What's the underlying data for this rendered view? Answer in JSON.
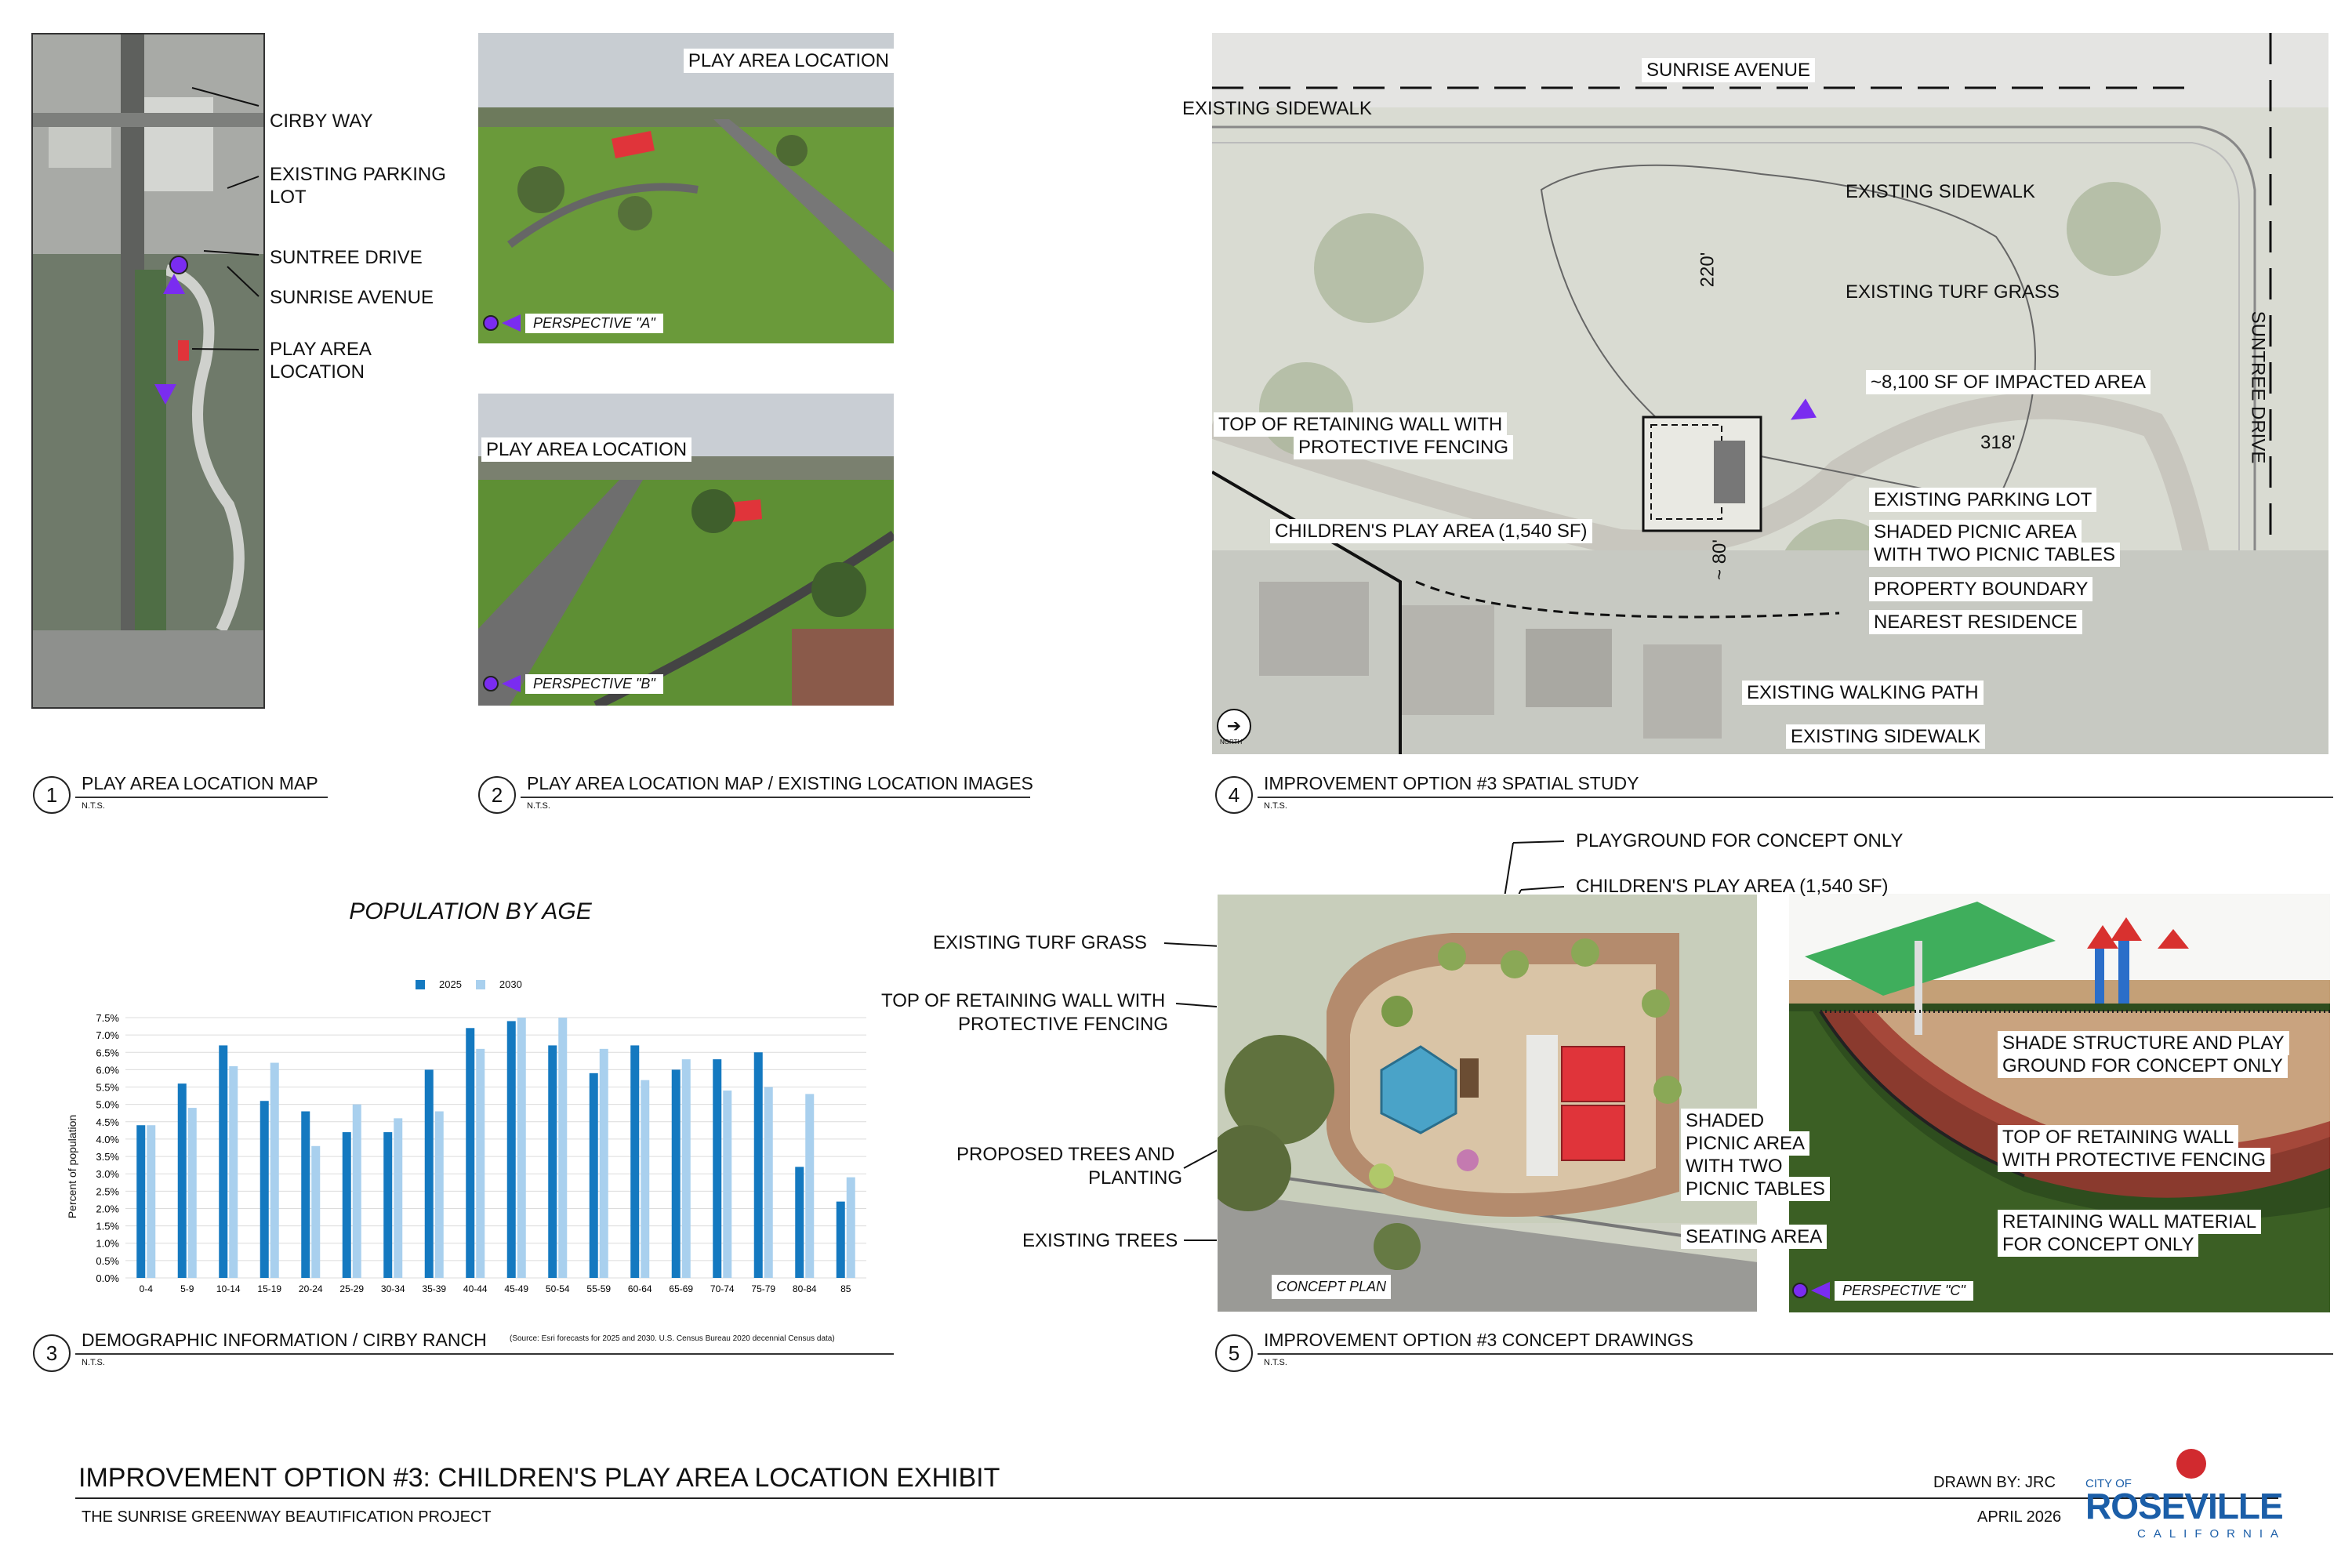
{
  "panel1": {
    "labels": {
      "cirby_way": "CIRBY WAY",
      "parking_1": "EXISTING PARKING",
      "parking_2": "LOT",
      "suntree": "SUNTREE DRIVE",
      "sunrise": "SUNRISE AVENUE",
      "play_1": "PLAY AREA",
      "play_2": "LOCATION"
    },
    "caption": {
      "number": "1",
      "title": "PLAY AREA LOCATION MAP",
      "nts": "N.T.S."
    }
  },
  "panel2": {
    "photo_a": {
      "label": "PLAY AREA LOCATION",
      "perspective": "PERSPECTIVE \"A\""
    },
    "photo_b": {
      "label": "PLAY AREA LOCATION",
      "perspective": "PERSPECTIVE \"B\""
    },
    "caption": {
      "number": "2",
      "title": "PLAY AREA LOCATION MAP / EXISTING LOCATION IMAGES",
      "nts": "N.T.S."
    }
  },
  "panel3": {
    "caption": {
      "number": "3",
      "title": "DEMOGRAPHIC INFORMATION / CIRBY RANCH",
      "source": "(Source: Esri forecasts for 2025 and 2030. U.S. Census Bureau 2020 decennial Census data)",
      "nts": "N.T.S."
    }
  },
  "panel4": {
    "labels": {
      "sunrise_ave": "SUNRISE AVENUE",
      "existing_sidewalk_top": "EXISTING SIDEWALK",
      "existing_sidewalk_right": "EXISTING SIDEWALK",
      "turf": "EXISTING TURF GRASS",
      "suntree": "SUNTREE DRIVE",
      "impacted": "~8,100 SF OF IMPACTED AREA",
      "dim_220": "220'",
      "dim_318": "318'",
      "dim_80": "~ 80'",
      "wall_1": "TOP OF RETAINING WALL WITH",
      "wall_2": "PROTECTIVE FENCING",
      "play_area": "CHILDREN'S PLAY AREA (1,540 SF)",
      "parking": "EXISTING PARKING LOT",
      "picnic_1": "SHADED PICNIC AREA",
      "picnic_2": "WITH TWO PICNIC TABLES",
      "boundary": "PROPERTY BOUNDARY",
      "residence": "NEAREST RESIDENCE",
      "walking": "EXISTING WALKING PATH",
      "sidewalk_bottom": "EXISTING SIDEWALK",
      "north": "NORTH"
    },
    "caption": {
      "number": "4",
      "title": "IMPROVEMENT OPTION #3 SPATIAL STUDY",
      "nts": "N.T.S."
    }
  },
  "panel5": {
    "labels": {
      "playground": "PLAYGROUND FOR CONCEPT ONLY",
      "play_area": "CHILDREN'S PLAY AREA (1,540 SF)",
      "turf": "EXISTING TURF GRASS",
      "wall_1": "TOP OF RETAINING WALL WITH",
      "wall_2": "PROTECTIVE FENCING",
      "trees_1": "PROPOSED TREES AND",
      "trees_2": "PLANTING",
      "existing_trees": "EXISTING TREES",
      "picnic_1": "SHADED",
      "picnic_2": "PICNIC AREA",
      "picnic_3": "WITH TWO",
      "picnic_4": "PICNIC TABLES",
      "seating": "SEATING AREA",
      "concept_plan": "CONCEPT PLAN",
      "shade_1": "SHADE STRUCTURE AND PLAY",
      "shade_2": "GROUND FOR CONCEPT ONLY",
      "rwall_1": "TOP OF RETAINING WALL",
      "rwall_2": "WITH PROTECTIVE FENCING",
      "mat_1": "RETAINING WALL MATERIAL",
      "mat_2": "FOR CONCEPT ONLY",
      "perspective": "PERSPECTIVE \"C\""
    },
    "caption": {
      "number": "5",
      "title": "IMPROVEMENT OPTION #3 CONCEPT DRAWINGS",
      "nts": "N.T.S."
    }
  },
  "titleblock": {
    "title": "IMPROVEMENT OPTION #3: CHILDREN'S PLAY AREA LOCATION EXHIBIT",
    "subtitle": "THE SUNRISE GREENWAY BEAUTIFICATION PROJECT",
    "drawn_by": "DRAWN BY: JRC",
    "date": "APRIL 2026",
    "logo_city": "CITY OF",
    "logo_name": "ROSEVILLE",
    "logo_state": "CALIFORNIA"
  },
  "colors": {
    "bar_2025": "#1479c0",
    "bar_2030": "#a9d0ee",
    "marker": "#7a2cf0",
    "play_red": "#e0343a"
  },
  "chart_data": {
    "type": "bar",
    "title": "POPULATION BY AGE",
    "xlabel": "",
    "ylabel": "Percent of population",
    "ylim": [
      0,
      7.5
    ],
    "yticks": [
      "0.0%",
      "0.5%",
      "1.0%",
      "1.5%",
      "2.0%",
      "2.5%",
      "3.0%",
      "3.5%",
      "4.0%",
      "4.5%",
      "5.0%",
      "5.5%",
      "6.0%",
      "6.5%",
      "7.0%",
      "7.5%"
    ],
    "legend": "top-center",
    "categories": [
      "0-4",
      "5-9",
      "10-14",
      "15-19",
      "20-24",
      "25-29",
      "30-34",
      "35-39",
      "40-44",
      "45-49",
      "50-54",
      "55-59",
      "60-64",
      "65-69",
      "70-74",
      "75-79",
      "80-84",
      "85"
    ],
    "series": [
      {
        "name": "2025",
        "color": "#1479c0",
        "values": [
          4.4,
          5.6,
          6.7,
          5.1,
          4.8,
          4.2,
          4.2,
          6.0,
          7.2,
          7.4,
          6.7,
          5.9,
          6.7,
          6.0,
          6.3,
          6.5,
          3.2,
          2.2
        ]
      },
      {
        "name": "2030",
        "color": "#a9d0ee",
        "values": [
          4.4,
          4.9,
          6.1,
          6.2,
          3.8,
          5.0,
          4.6,
          4.8,
          6.6,
          7.5,
          7.5,
          6.6,
          5.7,
          6.3,
          5.4,
          5.5,
          5.3,
          2.9
        ]
      }
    ]
  }
}
